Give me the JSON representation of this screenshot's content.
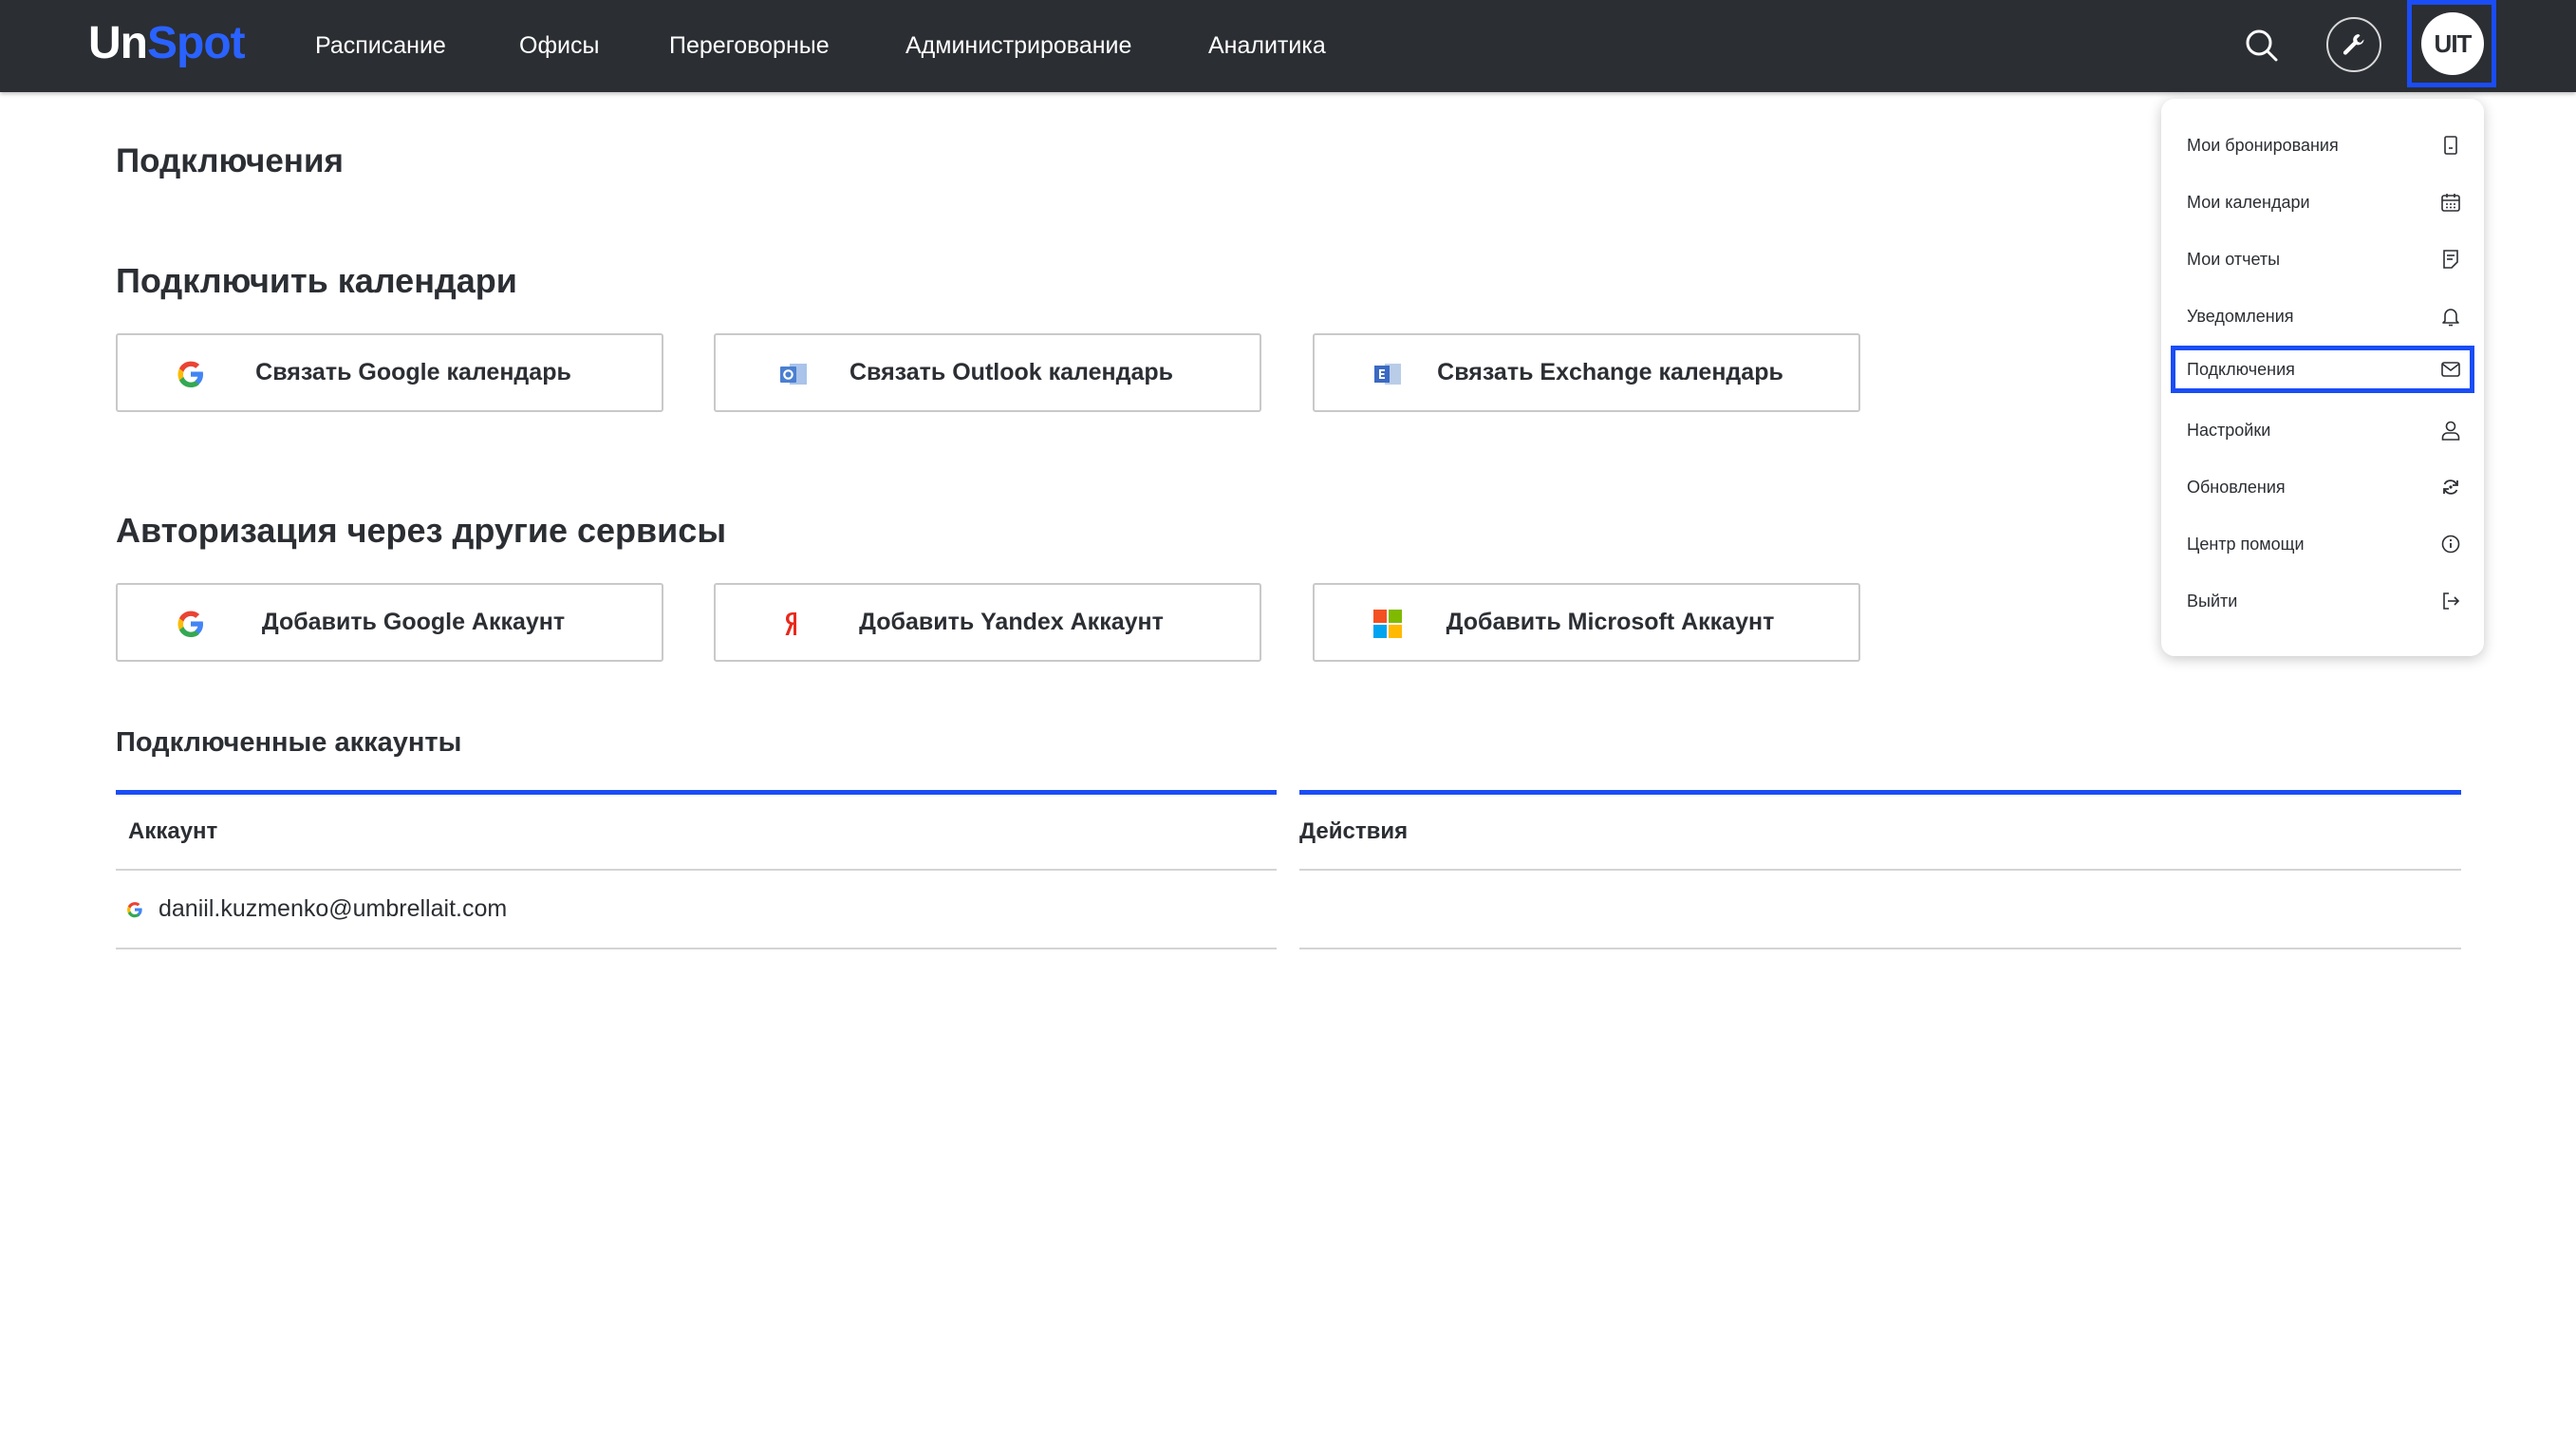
{
  "app": {
    "logo_part1": "Un",
    "logo_part2": "Spot",
    "avatar_initials": "UIT"
  },
  "nav": [
    {
      "label": "Расписание"
    },
    {
      "label": "Офисы"
    },
    {
      "label": "Переговорные"
    },
    {
      "label": "Администрирование"
    },
    {
      "label": "Аналитика"
    }
  ],
  "page": {
    "title": "Подключения"
  },
  "calendars": {
    "title": "Подключить календари",
    "buttons": [
      {
        "label": "Связать Google календарь",
        "icon": "google-icon"
      },
      {
        "label": "Связать Outlook календарь",
        "icon": "outlook-icon"
      },
      {
        "label": "Связать Exchange календарь",
        "icon": "exchange-icon"
      }
    ]
  },
  "auth": {
    "title": "Авторизация через другие сервисы",
    "buttons": [
      {
        "label": "Добавить Google Аккаунт",
        "icon": "google-icon"
      },
      {
        "label": "Добавить Yandex Аккаунт",
        "icon": "yandex-icon"
      },
      {
        "label": "Добавить Microsoft Аккаунт",
        "icon": "microsoft-icon"
      }
    ]
  },
  "accounts": {
    "title": "Подключенные аккаунты",
    "columns": [
      "Аккаунт",
      "Действия"
    ],
    "rows": [
      {
        "account": "daniil.kuzmenko@umbrellait.com",
        "provider": "google-icon"
      }
    ]
  },
  "menu": {
    "items": [
      {
        "label": "Мои бронирования",
        "icon": "bookmark-icon"
      },
      {
        "label": "Мои календари",
        "icon": "calendar-icon"
      },
      {
        "label": "Мои отчеты",
        "icon": "report-icon"
      },
      {
        "label": "Уведомления",
        "icon": "bell-icon"
      },
      {
        "label": "Подключения",
        "icon": "mail-icon",
        "active": true
      },
      {
        "label": "Настройки",
        "icon": "user-icon"
      },
      {
        "label": "Обновления",
        "icon": "refresh-icon"
      },
      {
        "label": "Центр помощи",
        "icon": "info-icon"
      },
      {
        "label": "Выйти",
        "icon": "logout-icon"
      }
    ]
  },
  "colors": {
    "topbar": "#2b2e33",
    "accent": "#1a4df5",
    "logo_accent": "#2a62ff"
  }
}
